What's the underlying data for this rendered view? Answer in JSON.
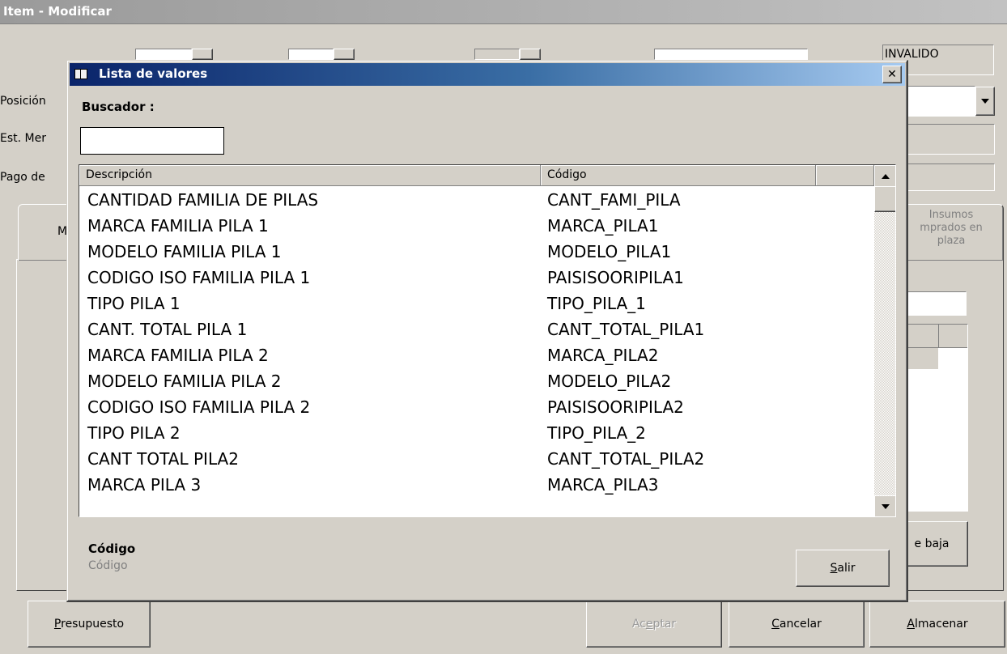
{
  "window": {
    "title": "Item - Modificar"
  },
  "background_form": {
    "status_value": "INVALIDO",
    "labels": {
      "posicion": "Posición",
      "est_mer": "Est. Mer",
      "pago_de": "Pago de"
    },
    "tab_partial": "M",
    "tab_insumos": [
      "Insumos",
      "mprados en",
      "plaza"
    ],
    "baja_label": "e baja"
  },
  "dialog": {
    "title": "Lista de valores",
    "buscador_label": "Buscador :",
    "search_value": "",
    "columns": [
      "Descripción",
      "Código"
    ],
    "rows": [
      {
        "descripcion": "CANTIDAD FAMILIA DE PILAS",
        "codigo": "CANT_FAMI_PILA"
      },
      {
        "descripcion": "MARCA  FAMILIA PILA 1",
        "codigo": "MARCA_PILA1"
      },
      {
        "descripcion": "MODELO FAMILIA PILA 1",
        "codigo": "MODELO_PILA1"
      },
      {
        "descripcion": "CODIGO ISO FAMILIA PILA 1",
        "codigo": "PAISISOORIPILA1"
      },
      {
        "descripcion": "TIPO PILA 1",
        "codigo": "TIPO_PILA_1"
      },
      {
        "descripcion": "CANT. TOTAL PILA 1",
        "codigo": "CANT_TOTAL_PILA1"
      },
      {
        "descripcion": "MARCA  FAMILIA PILA 2",
        "codigo": "MARCA_PILA2"
      },
      {
        "descripcion": "MODELO FAMILIA PILA 2",
        "codigo": "MODELO_PILA2"
      },
      {
        "descripcion": "CODIGO ISO FAMILIA PILA 2",
        "codigo": "PAISISOORIPILA2"
      },
      {
        "descripcion": "TIPO PILA 2",
        "codigo": "TIPO_PILA_2"
      },
      {
        "descripcion": "CANT TOTAL PILA2",
        "codigo": "CANT_TOTAL_PILA2"
      },
      {
        "descripcion": "MARCA PILA 3",
        "codigo": "MARCA_PILA3"
      }
    ],
    "field_label": "Código",
    "field_hint": "Código",
    "salir_first": "S",
    "salir_rest": "alir"
  },
  "bottom_buttons": {
    "presupuesto_first": "P",
    "presupuesto_rest": "resupuesto",
    "aceptar_pre": "Ac",
    "aceptar_ul": "e",
    "aceptar_post": "ptar",
    "cancelar_first": "C",
    "cancelar_rest": "ancelar",
    "almacenar_first": "A",
    "almacenar_rest": "lmacenar"
  }
}
